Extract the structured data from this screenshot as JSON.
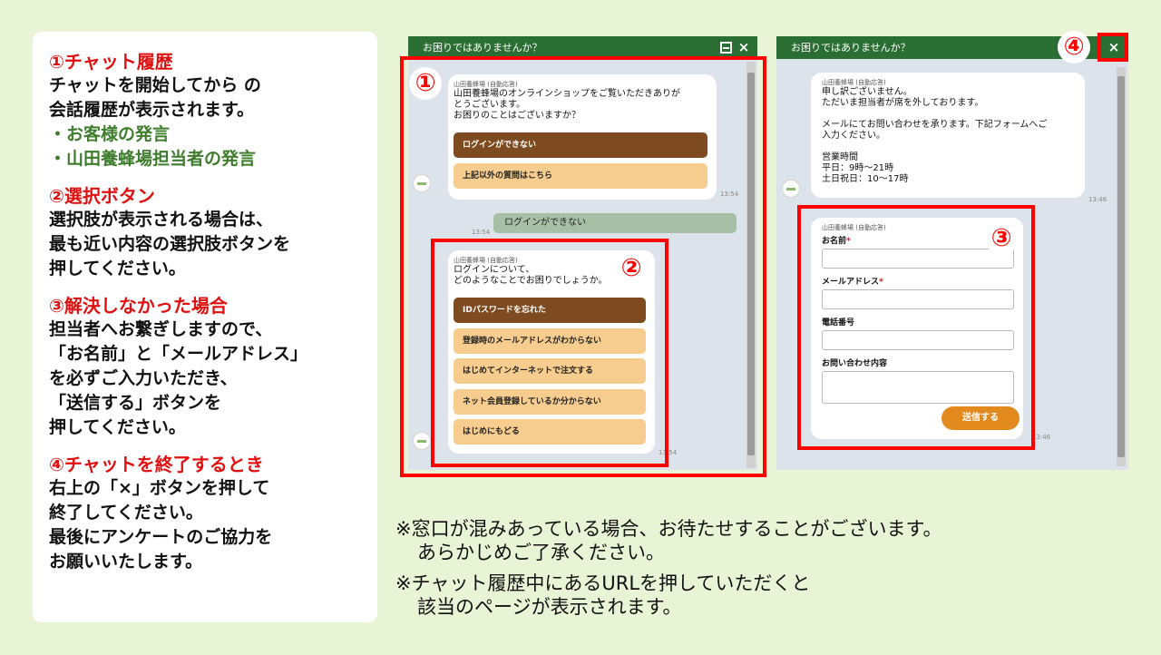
{
  "guide": {
    "s1": {
      "title": "①チャット履歴",
      "lines": [
        "チャットを開始してから の",
        "会話履歴が表示されます。"
      ],
      "items": [
        "・お客様の発言",
        "・山田養蜂場担当者の発言"
      ]
    },
    "s2": {
      "title": "②選択ボタン",
      "lines": [
        "選択肢が表示される場合は、",
        "最も近い内容の選択肢ボタンを",
        "押してください。"
      ]
    },
    "s3": {
      "title": "③解決しなかった場合",
      "lines": [
        "担当者へお繋ぎしますので、",
        "「お名前」と「メールアドレス」",
        "を必ずご入力いただき、",
        "「送信する」ボタンを",
        "押してください。"
      ]
    },
    "s4": {
      "title": "④チャットを終了するとき",
      "lines": [
        "右上の「×」ボタンを押して",
        "終了してください。",
        "最後にアンケートのご協力を",
        "お願いいたします。"
      ]
    }
  },
  "notes": [
    {
      "line1": "※窓口が混みあっている場合、お待たせすることがございます。",
      "line2": "あらかじめご了承ください。"
    },
    {
      "line1": "※チャット履歴中にあるURLを押していただくと",
      "line2": "該当のページが表示されます。"
    }
  ],
  "chat1": {
    "header_title": "お困りではありませんか？",
    "min_icon": "minimize-icon",
    "close_icon": "×",
    "msg1": {
      "sender": "山田養蜂場 (自動応答)",
      "lines": [
        "山田養蜂場のオンラインショップをご覧いただきありが",
        "とうございます。",
        "お困りのことはございますか？"
      ],
      "options": [
        "ログインができない",
        "上記以外の質問はこちら"
      ],
      "time": "13:54"
    },
    "user_msg": {
      "text": "ログインができない",
      "time": "13:54"
    },
    "msg2": {
      "sender": "山田養蜂場 (自動応答)",
      "lines": [
        "ログインについて、",
        "どのようなことでお困りでしょうか。"
      ],
      "options": [
        "IDパスワードを忘れた",
        "登録時のメールアドレスがわからない",
        "はじめてインターネットで注文する",
        "ネット会員登録しているか分からない",
        "はじめにもどる"
      ],
      "time": "13:54"
    },
    "avatar_label": "山田養蜂場"
  },
  "chat2": {
    "header_title": "お困りではありませんか？",
    "close_icon": "×",
    "msg1": {
      "sender": "山田養蜂場 (自動応答)",
      "lines": [
        "申し訳ございません。",
        "ただいま担当者が席を外しております。",
        "",
        "メールにてお問い合わせを承ります。下記フォームへご",
        "入力ください。",
        "",
        "営業時間",
        "平日：9時〜21時",
        "土日祝日：10〜17時"
      ],
      "time": "13:46"
    },
    "form": {
      "sender": "山田養蜂場 (自動応答)",
      "name_label": "お名前",
      "email_label": "メールアドレス",
      "required_mark": "*",
      "phone_label": "電話番号",
      "inquiry_label": "お問い合わせ内容",
      "submit_label": "送信する",
      "time": "13:46"
    }
  },
  "badges": [
    "①",
    "②",
    "③",
    "④"
  ],
  "colors": {
    "highlight": "#ff0000",
    "header_green": "#2a6e33",
    "selected_option": "#7d4b1f",
    "option": "#f6cd8e",
    "submit": "#e38a1f",
    "guide_title": "#e01010",
    "guide_green": "#3e7d2c"
  }
}
